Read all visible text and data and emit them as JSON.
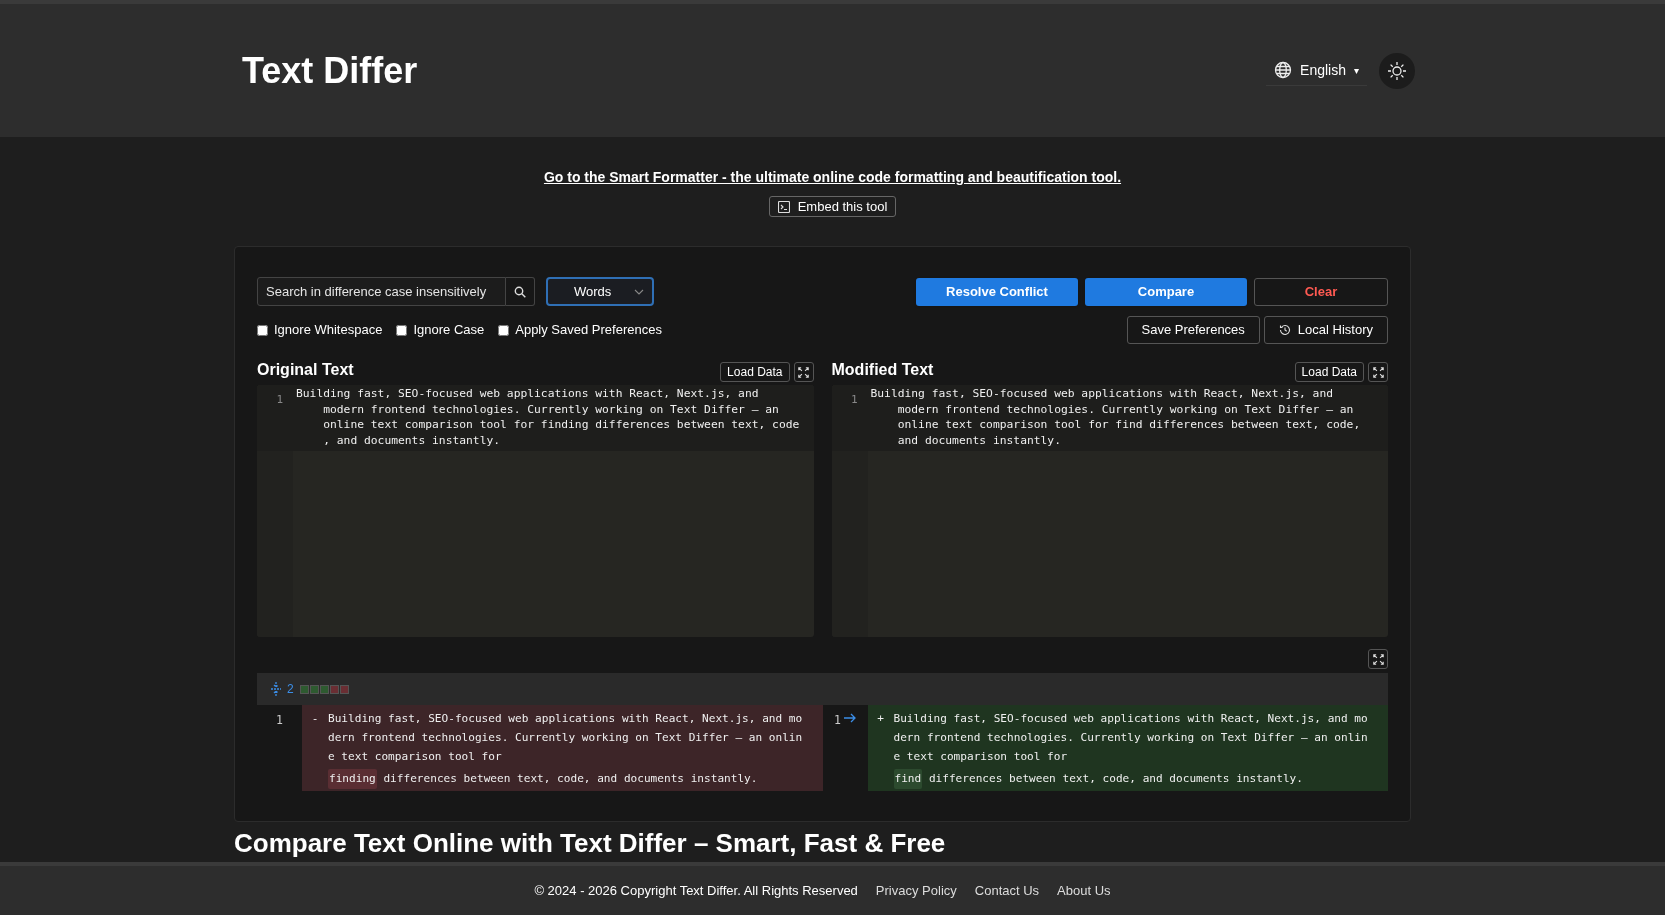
{
  "header": {
    "title": "Text Differ",
    "language": "English",
    "language_caret": "▾"
  },
  "promo_link": "Go to the Smart Formatter - the ultimate online code formatting and beautification tool.",
  "embed_button": "Embed this tool",
  "toolbar": {
    "search": {
      "placeholder": "Search in difference case insensitively"
    },
    "mode_select": {
      "value": "Words"
    },
    "buttons": [
      {
        "label": "Resolve Conflict",
        "kind": "primary"
      },
      {
        "label": "Compare",
        "kind": "primary"
      },
      {
        "label": "Clear",
        "kind": "danger"
      }
    ],
    "options": [
      {
        "label": "Ignore Whitespace",
        "checked": false
      },
      {
        "label": "Ignore Case",
        "checked": false
      },
      {
        "label": "Apply Saved Preferences",
        "checked": false
      }
    ],
    "secondary_buttons": [
      {
        "label": "Save Preferences",
        "kind": "plain"
      },
      {
        "label": "Local History",
        "kind": "history"
      }
    ]
  },
  "editors": [
    {
      "title": "Original Text",
      "load_button": "Load Data",
      "line_number": "1",
      "rows": [
        "Building fast, SEO-focused web applications with React, Next.js, and",
        "    modern frontend technologies. Currently working on Text Differ — an",
        "    online text comparison tool for finding differences between text, code",
        "    , and documents instantly."
      ]
    },
    {
      "title": "Modified Text",
      "load_button": "Load Data",
      "line_number": "1",
      "rows": [
        "Building fast, SEO-focused web applications with React, Next.js, and",
        "    modern frontend technologies. Currently working on Text Differ — an",
        "    online text comparison tool for find differences between text, code,",
        "    and documents instantly."
      ]
    }
  ],
  "diff": {
    "count": "2",
    "markers": [
      {
        "color": "#2e5a30"
      },
      {
        "color": "#2e5a30"
      },
      {
        "color": "#2e5a30"
      },
      {
        "color": "#6a2e33"
      },
      {
        "color": "#6a2e33"
      }
    ],
    "sides": [
      {
        "kind": "removed",
        "line_number": "1",
        "sign": "-",
        "rows": [
          "Building fast, SEO-focused web applications with React, Next.js, and mo",
          "dern frontend technologies. Currently working on Text Differ — an onlin",
          "e text comparison tool for"
        ],
        "changed_word": "finding",
        "rest": " differences between text, code, and documents instantly."
      },
      {
        "kind": "added",
        "line_number": "1",
        "sign": "+",
        "rows": [
          "Building fast, SEO-focused web applications with React, Next.js, and mo",
          "dern frontend technologies. Currently working on Text Differ — an onlin",
          "e text comparison tool for"
        ],
        "changed_word": "find",
        "rest": " differences between text, code, and documents instantly."
      }
    ]
  },
  "section_heading": "Compare Text Online with Text Differ – Smart, Fast & Free",
  "footer": {
    "copyright": "© 2024 - 2026 Copyright Text Differ. All Rights Reserved",
    "links": [
      "Privacy Policy",
      "Contact Us",
      "About Us"
    ]
  }
}
